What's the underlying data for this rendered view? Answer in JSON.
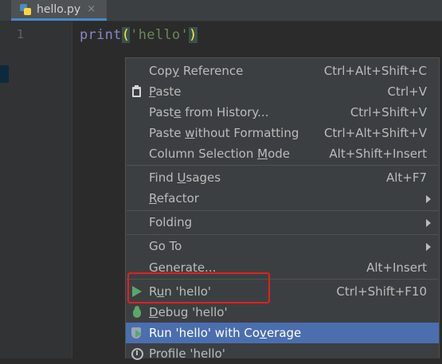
{
  "tab": {
    "filename": "hello.py",
    "close_glyph": "×",
    "icon": "python-file-icon"
  },
  "editor": {
    "line_number": "1",
    "code": {
      "keyword": "print",
      "open_paren": "(",
      "string": "'hello'",
      "close_paren": ")"
    }
  },
  "context_menu": {
    "items": [
      {
        "label_parts": [
          "Cop",
          "y",
          " Reference"
        ],
        "shortcut": "Ctrl+Alt+Shift+C"
      },
      {
        "label_parts": [
          "",
          "P",
          "aste"
        ],
        "shortcut": "Ctrl+V",
        "icon": "paste-icon"
      },
      {
        "label_parts": [
          "Past",
          "e",
          " from History..."
        ],
        "shortcut": "Ctrl+Shift+V"
      },
      {
        "label_parts": [
          "Paste ",
          "w",
          "ithout Formatting"
        ],
        "shortcut": "Ctrl+Alt+Shift+V"
      },
      {
        "label_parts": [
          "Column Selection ",
          "M",
          "ode"
        ],
        "shortcut": "Alt+Shift+Insert"
      },
      {
        "label_parts": [
          "Find ",
          "U",
          "sages"
        ],
        "shortcut": "Alt+F7"
      },
      {
        "label_parts": [
          "",
          "R",
          "efactor"
        ],
        "submenu": true
      },
      {
        "label_parts": [
          "Folding",
          "",
          ""
        ],
        "submenu": true
      },
      {
        "label_parts": [
          "Go To",
          "",
          ""
        ],
        "submenu": true
      },
      {
        "label_parts": [
          "Generate...",
          "",
          ""
        ],
        "shortcut": "Alt+Insert"
      },
      {
        "label_parts": [
          "R",
          "u",
          "n 'hello'"
        ],
        "shortcut": "Ctrl+Shift+F10",
        "icon": "run-icon"
      },
      {
        "label_parts": [
          "",
          "D",
          "ebug 'hello'"
        ],
        "icon": "debug-icon"
      },
      {
        "label_parts": [
          "Run 'hello' with Co",
          "v",
          "erage"
        ],
        "icon": "coverage-icon",
        "selected": true
      },
      {
        "label_parts": [
          "Profile 'hello'",
          "",
          ""
        ],
        "icon": "profile-icon"
      }
    ]
  },
  "colors": {
    "editor_bg": "#2b2b2b",
    "menu_bg": "#3c3f41",
    "selection": "#4b6eaf",
    "annotation": "#e02020",
    "run_green": "#59a869"
  }
}
